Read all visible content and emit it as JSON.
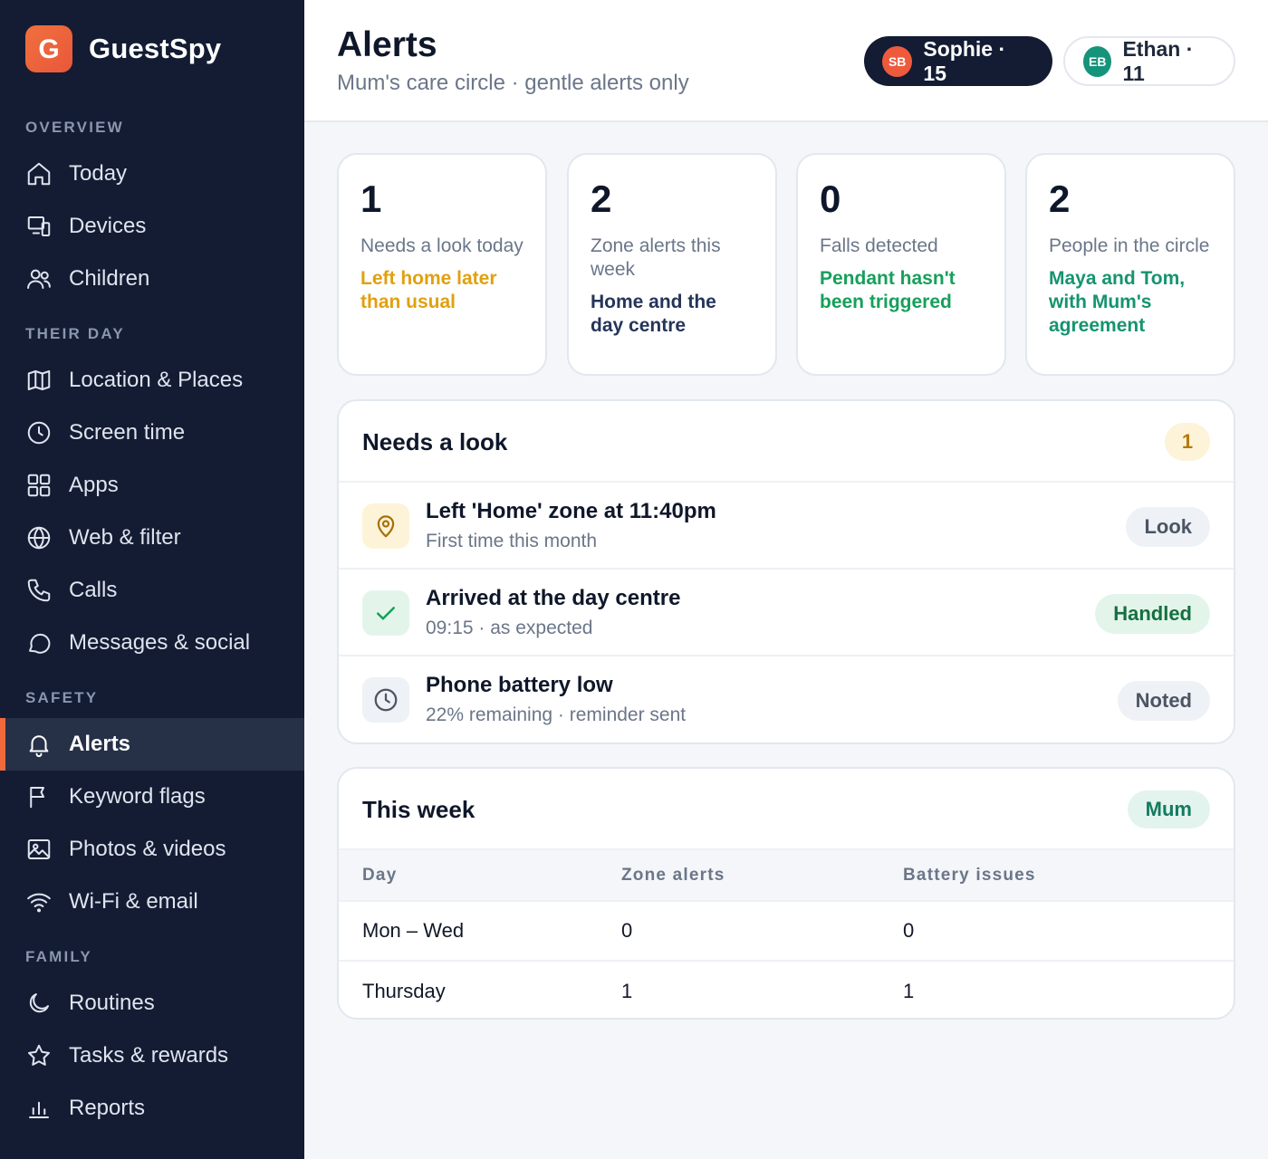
{
  "app": {
    "name": "GuestSpy",
    "logo_letter": "G",
    "accent": "#f06a3e"
  },
  "sidebar": {
    "sections": [
      {
        "title": "OVERVIEW",
        "items": [
          {
            "label": "Today",
            "icon": "home-icon"
          },
          {
            "label": "Devices",
            "icon": "devices-icon"
          },
          {
            "label": "Children",
            "icon": "users-icon"
          }
        ]
      },
      {
        "title": "THEIR DAY",
        "items": [
          {
            "label": "Location & Places",
            "icon": "map-icon"
          },
          {
            "label": "Screen time",
            "icon": "clock-icon"
          },
          {
            "label": "Apps",
            "icon": "apps-grid-icon"
          },
          {
            "label": "Web & filter",
            "icon": "globe-icon"
          },
          {
            "label": "Calls",
            "icon": "phone-icon"
          },
          {
            "label": "Messages & social",
            "icon": "chat-bubble-icon"
          }
        ]
      },
      {
        "title": "SAFETY",
        "items": [
          {
            "label": "Alerts",
            "icon": "bell-icon",
            "active": true
          },
          {
            "label": "Keyword flags",
            "icon": "flag-icon"
          },
          {
            "label": "Photos & videos",
            "icon": "image-icon"
          },
          {
            "label": "Wi-Fi & email",
            "icon": "wifi-icon"
          }
        ]
      },
      {
        "title": "FAMILY",
        "items": [
          {
            "label": "Routines",
            "icon": "moon-icon"
          },
          {
            "label": "Tasks & rewards",
            "icon": "star-icon"
          },
          {
            "label": "Reports",
            "icon": "bar-chart-icon"
          }
        ]
      }
    ]
  },
  "header": {
    "title": "Alerts",
    "subtitle": "Mum's care circle · gentle alerts only",
    "profiles": [
      {
        "initials": "SB",
        "label": "Sophie · 15",
        "selected": true
      },
      {
        "initials": "EB",
        "label": "Ethan · 11",
        "selected": false
      }
    ]
  },
  "stats": [
    {
      "value": "1",
      "label": "Needs a look today",
      "note": "Left home later than usual",
      "note_color": "#e0a10f"
    },
    {
      "value": "2",
      "label": "Zone alerts this week",
      "note": "Home and the day centre",
      "note_color": "#25355a"
    },
    {
      "value": "0",
      "label": "Falls detected",
      "note": "Pendant hasn't been triggered",
      "note_color": "#16a05a"
    },
    {
      "value": "2",
      "label": "People in the circle",
      "note": "Maya and Tom, with Mum's agreement",
      "note_color": "#15946f"
    }
  ],
  "needs_look": {
    "title": "Needs a look",
    "count": "1",
    "alerts": [
      {
        "icon": "map-pin-icon",
        "title": "Left 'Home' zone at 11:40pm",
        "subtitle": "First time this month",
        "status": "Look"
      },
      {
        "icon": "checkmark-icon",
        "title": "Arrived at the day centre",
        "subtitle": "09:15 · as expected",
        "status": "Handled"
      },
      {
        "icon": "clock-icon",
        "title": "Phone battery low",
        "subtitle": "22% remaining · reminder sent",
        "status": "Noted"
      }
    ]
  },
  "this_week": {
    "title": "This week",
    "badge": "Mum",
    "columns": [
      "Day",
      "Zone alerts",
      "Battery issues"
    ],
    "rows": [
      [
        "Mon – Wed",
        "0",
        "0"
      ],
      [
        "Thursday",
        "1",
        "1"
      ]
    ]
  }
}
